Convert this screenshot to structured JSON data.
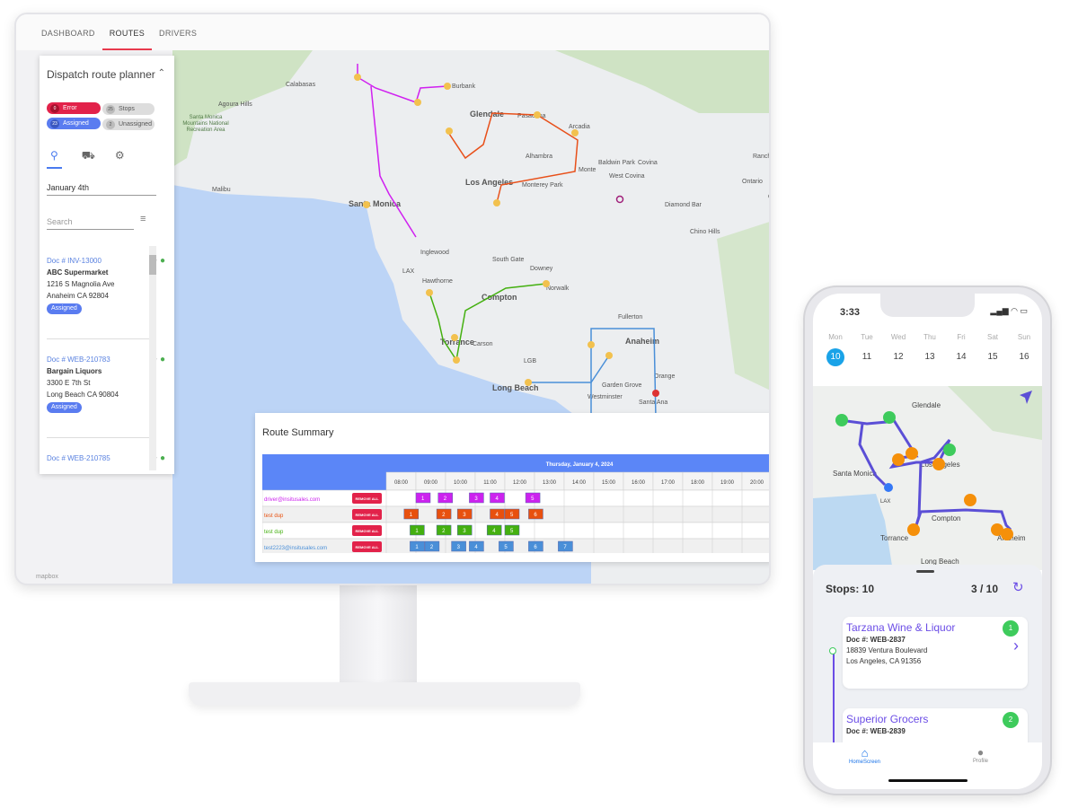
{
  "desktop": {
    "tabs": [
      {
        "label": "DASHBOARD"
      },
      {
        "label": "ROUTES",
        "active": true
      },
      {
        "label": "DRIVERS"
      }
    ],
    "panel": {
      "title": "Dispatch route planner",
      "chips": {
        "error": {
          "count": "0",
          "label": "Error"
        },
        "stops": {
          "count": "25",
          "label": "Stops"
        },
        "assigned": {
          "count": "23",
          "label": "Assigned"
        },
        "unassigned": {
          "count": "2",
          "label": "Unassigned"
        }
      },
      "date": "January 4th",
      "search_placeholder": "Search",
      "items": [
        {
          "doc": "Doc # INV-13000",
          "name": "ABC Supermarket",
          "addr1": "1216 S Magnolia Ave",
          "addr2": "Anaheim CA 92804",
          "status": "Assigned"
        },
        {
          "doc": "Doc # WEB-210783",
          "name": "Bargain Liquors",
          "addr1": "3300 E 7th St",
          "addr2": "Long Beach CA 90804",
          "status": "Assigned"
        },
        {
          "doc": "Doc # WEB-210785"
        }
      ]
    },
    "map": {
      "labels": [
        "Burbank",
        "Glendale",
        "Pasadena",
        "Arcadia",
        "Alhambra",
        "Los Angeles",
        "Monterey Park",
        "Monte",
        "Baldwin Park",
        "Covina",
        "West Covina",
        "Diamond Bar",
        "Ontario",
        "Chino Hills",
        "Santa Monica",
        "Inglewood",
        "South Gate",
        "Downey",
        "Hawthorne",
        "Compton",
        "Norwalk",
        "Fullerton",
        "Torrance",
        "Carson",
        "Anaheim",
        "Long Beach",
        "Garden Grove",
        "Westminster",
        "Orange",
        "Santa Ana",
        "Calabasas",
        "Agoura Hills",
        "Malibu",
        "LAX",
        "LGB",
        "Rancho Cucamonga",
        "ONT",
        "Santa Monica Mountains National Recreation Area"
      ],
      "attribution": "mapbox"
    },
    "summary": {
      "title": "Route Summary",
      "date_header": "Thursday, January 4, 2024",
      "hours": [
        "08:00",
        "09:00",
        "10:00",
        "11:00",
        "12:00",
        "13:00",
        "14:00",
        "15:00",
        "16:00",
        "17:00",
        "18:00",
        "19:00",
        "20:00"
      ],
      "remove_label": "REMOVE ALL",
      "rows": [
        {
          "driver": "driver@insitusales.com",
          "color": "#cc22ee",
          "stops": [
            {
              "n": "1",
              "t": 8.5
            },
            {
              "n": "2",
              "t": 9.25
            },
            {
              "n": "3",
              "t": 10.3
            },
            {
              "n": "4",
              "t": 11.0
            },
            {
              "n": "5",
              "t": 12.2
            }
          ]
        },
        {
          "driver": "test dup",
          "color": "#e8500e",
          "stops": [
            {
              "n": "1",
              "t": 8.1
            },
            {
              "n": "2",
              "t": 9.2
            },
            {
              "n": "3",
              "t": 9.9
            },
            {
              "n": "4",
              "t": 11.0
            },
            {
              "n": "5",
              "t": 11.5
            },
            {
              "n": "6",
              "t": 12.3
            }
          ]
        },
        {
          "driver": "test dup",
          "color": "#44b010",
          "stops": [
            {
              "n": "1",
              "t": 8.3
            },
            {
              "n": "2",
              "t": 9.2
            },
            {
              "n": "3",
              "t": 9.9
            },
            {
              "n": "4",
              "t": 10.9
            },
            {
              "n": "5",
              "t": 11.5
            }
          ]
        },
        {
          "driver": "test2223@insitusales.com",
          "color": "#4a8fd8",
          "stops": [
            {
              "n": "1",
              "t": 8.3
            },
            {
              "n": "2",
              "t": 8.8
            },
            {
              "n": "3",
              "t": 9.7
            },
            {
              "n": "4",
              "t": 10.3
            },
            {
              "n": "5",
              "t": 11.3
            },
            {
              "n": "6",
              "t": 12.3
            },
            {
              "n": "7",
              "t": 13.3
            }
          ]
        }
      ]
    }
  },
  "phone": {
    "time": "3:33",
    "days": [
      {
        "dow": "Mon",
        "d": "10",
        "selected": true
      },
      {
        "dow": "Tue",
        "d": "11"
      },
      {
        "dow": "Wed",
        "d": "12"
      },
      {
        "dow": "Thu",
        "d": "13"
      },
      {
        "dow": "Fri",
        "d": "14"
      },
      {
        "dow": "Sat",
        "d": "15"
      },
      {
        "dow": "Sun",
        "d": "16"
      }
    ],
    "map_labels": [
      "Glendale",
      "Los Angeles",
      "Santa Monica",
      "LAX",
      "Compton",
      "Torrance",
      "Anaheim",
      "Long Beach"
    ],
    "stops_label": "Stops: 10",
    "progress": "3 / 10",
    "cards": [
      {
        "name": "Tarzana Wine & Liquor",
        "doc": "Doc #: WEB-2837",
        "addr1": "18839 Ventura Boulevard",
        "addr2": "Los Angeles, CA  91356",
        "num": "1"
      },
      {
        "name": "Superior Grocers",
        "doc": "Doc #: WEB-2839",
        "num": "2"
      }
    ],
    "nav": {
      "home": "HomeScreen",
      "profile": "Profile"
    },
    "colors": {
      "route": "#5b4fd6",
      "accent": "#6b4de6",
      "done": "#3ecb5c",
      "pending": "#f5900a"
    }
  }
}
